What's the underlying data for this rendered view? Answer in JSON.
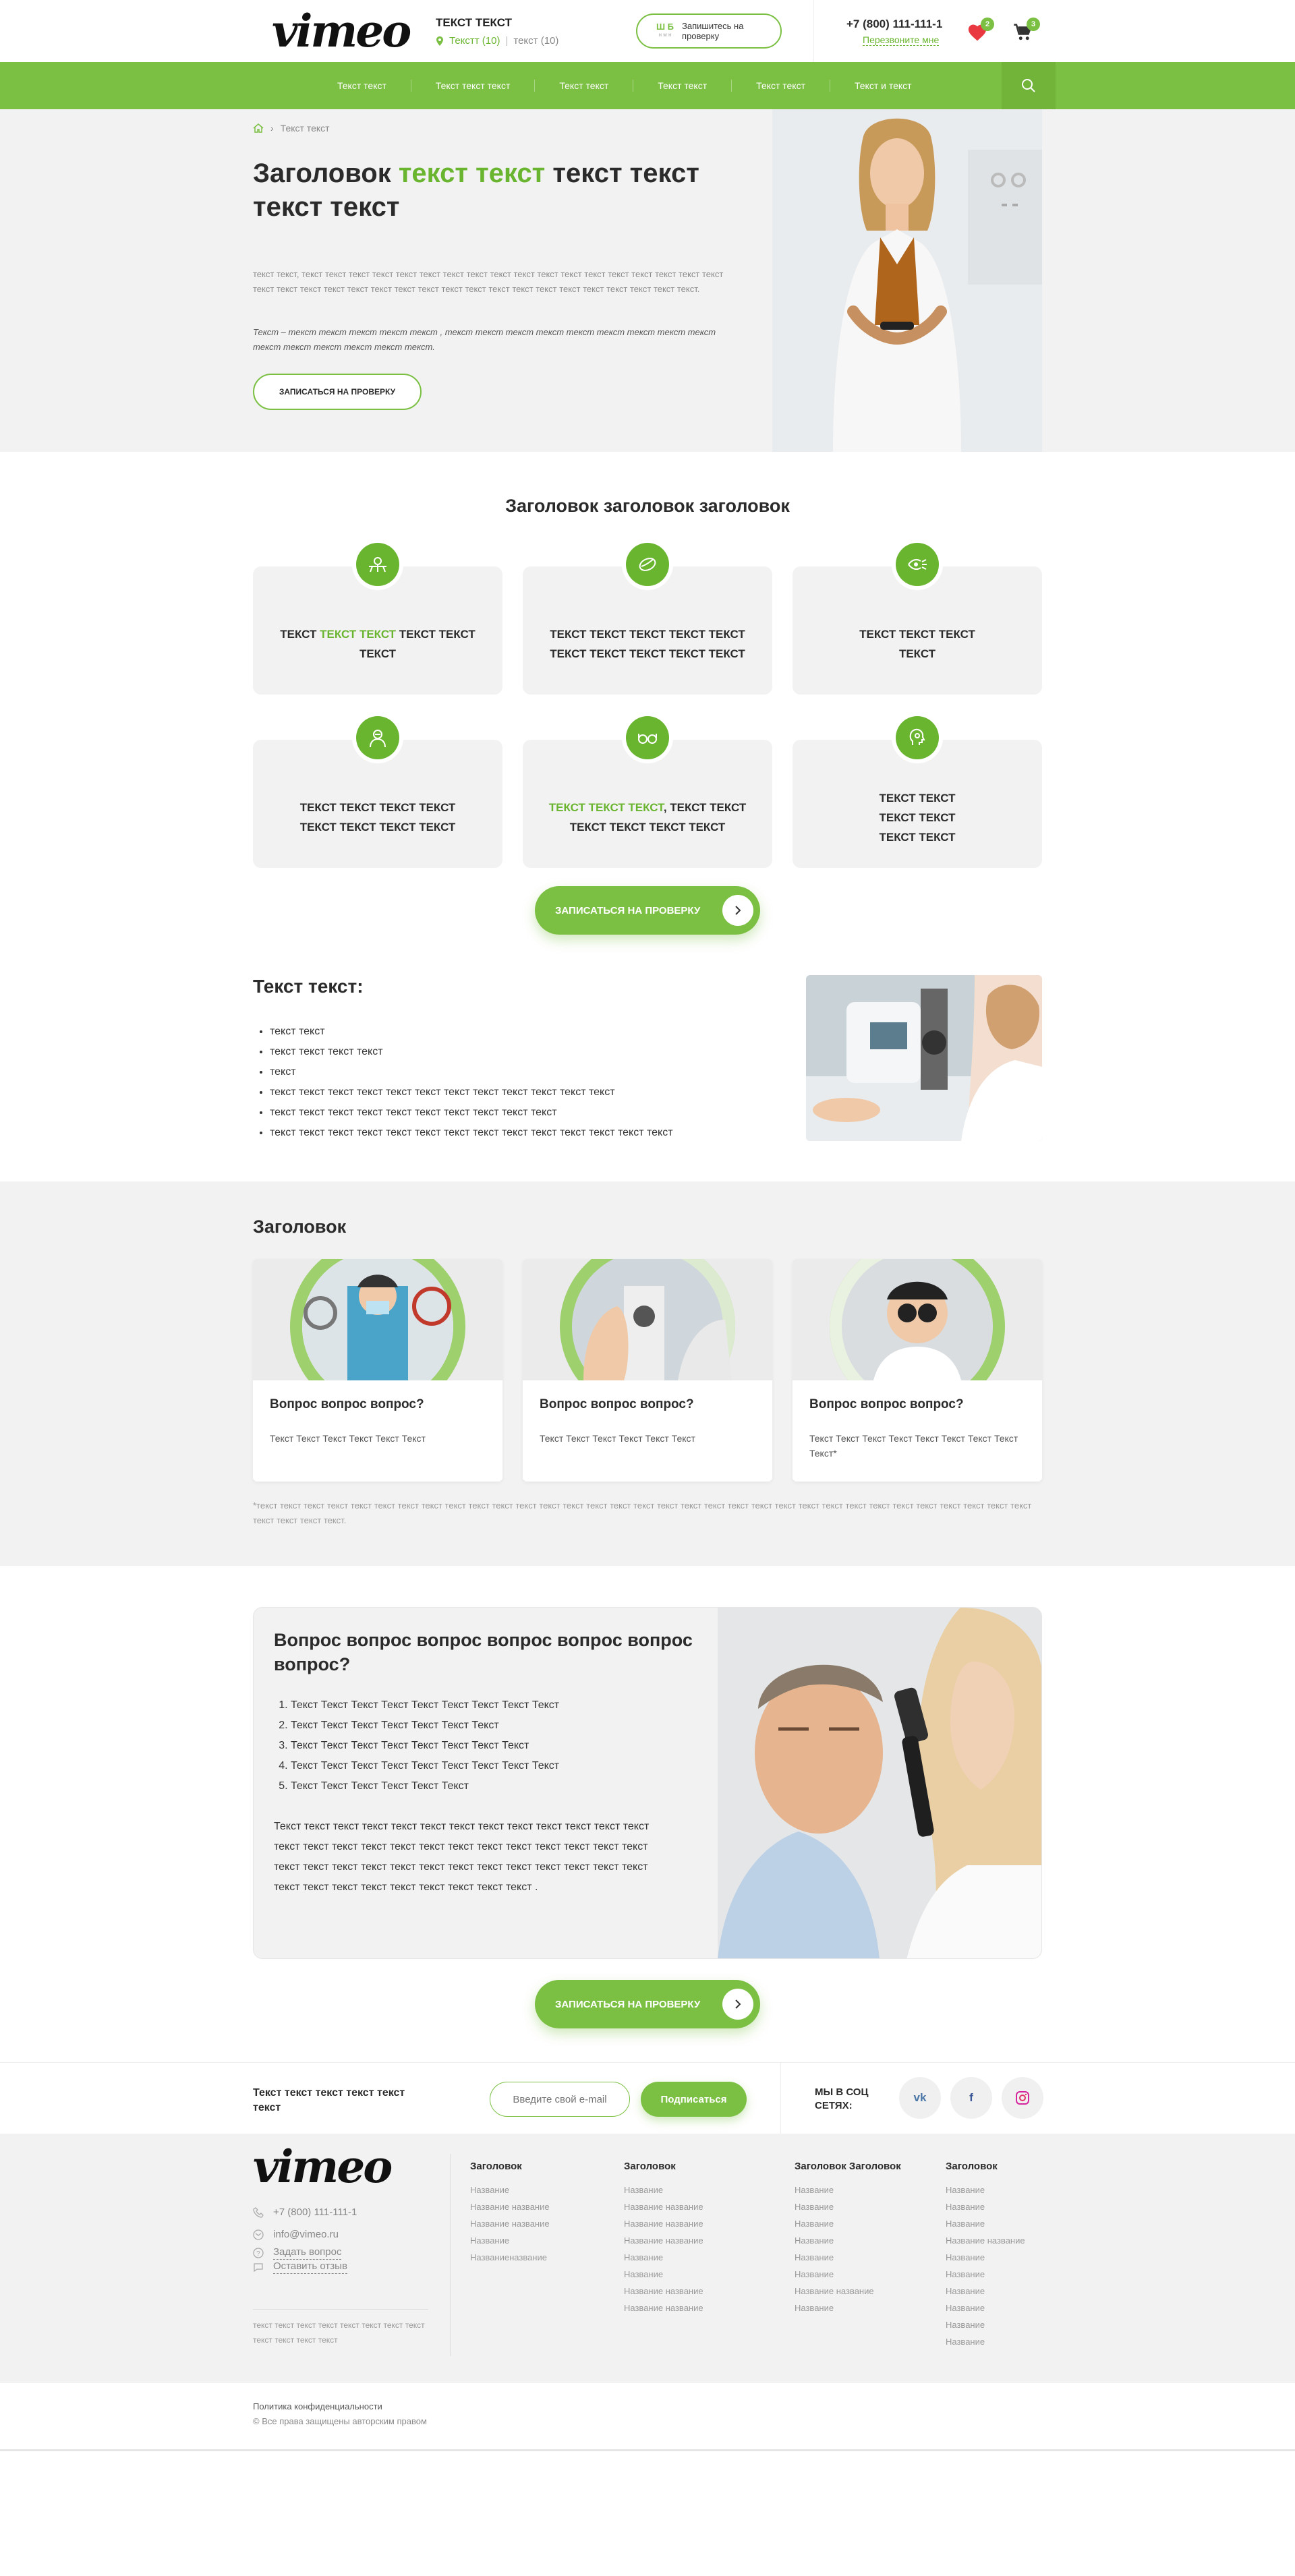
{
  "header": {
    "logo": "vimeo",
    "title": "ТЕКСТ ТЕКСТ",
    "location": "Текстт (10)",
    "location_alt": "текст (10)",
    "promo_badge": "Ш Б",
    "promo_badge_sub": "н м н",
    "promo_line1": "Запишитесь на",
    "promo_line2": "проверку",
    "phone": "+7 (800) 111-111-1",
    "callback": "Перезвоните мне",
    "favorites_count": "2",
    "cart_count": "3"
  },
  "nav": {
    "items": [
      "Текст текст",
      "Текст текст текст",
      "Текст текст",
      "Текст текст",
      "Текст текст",
      "Текст и текст"
    ]
  },
  "hero": {
    "breadcrumb": "Текст текст",
    "title_a": "Заголовок ",
    "title_green": "текст текст",
    "title_b": " текст текст текст текст",
    "para1": "текст текст, текст текст текст текст текст текст текст текст текст текст текст текст текст текст текст текст текст текст текст текст текст текст текст текст текст текст текст текст текст текст текст текст текст текст текст текст текст.",
    "para2": "Текст – текст текст текст  текст  текст , текст  текст  текст текст текст текст текст текст текст текст текст текст текст текст текст.",
    "button": "ЗАПИСАТЬСЯ НА ПРОВЕРКУ"
  },
  "features": {
    "title": "Заголовок заголовок заголовок",
    "cards": [
      {
        "a": "ТЕКСТ ",
        "g": "ТЕКСТ ТЕКСТ",
        "b": " ТЕКСТ ТЕКСТ ТЕКСТ"
      },
      {
        "a": "ТЕКСТ ТЕКСТ ТЕКСТ ТЕКСТ ТЕКСТ ТЕКСТ ТЕКСТ ТЕКСТ ТЕКСТ ТЕКСТ",
        "g": "",
        "b": ""
      },
      {
        "a": "ТЕКСТ ТЕКСТ ТЕКСТ ТЕКСТ",
        "g": "",
        "b": ""
      },
      {
        "a": "ТЕКСТ ТЕКСТ ТЕКСТ ТЕКСТ ТЕКСТ ТЕКСТ ТЕКСТ ТЕКСТ",
        "g": "",
        "b": ""
      },
      {
        "a": "",
        "g": "ТЕКСТ ТЕКСТ ТЕКСТ",
        "b": ", ТЕКСТ ТЕКСТ ТЕКСТ ТЕКСТ ТЕКСТ ТЕКСТ"
      },
      {
        "a": "ТЕКСТ ТЕКСТ ТЕКСТ ТЕКСТ ТЕКСТ ТЕКСТ",
        "g": "",
        "b": ""
      }
    ],
    "button": "ЗАПИСАТЬСЯ НА ПРОВЕРКУ"
  },
  "info": {
    "title": "Текст текст:",
    "items": [
      "текст текст",
      "текст текст текст текст",
      "текст",
      "текст текст текст текст текст текст текст текст текст текст текст текст",
      "текст текст текст текст текст текст текст текст текст текст",
      "текст текст текст текст текст текст текст текст текст текст текст текст текст текст"
    ]
  },
  "questions": {
    "title": "Заголовок",
    "cards": [
      {
        "title": "Вопрос вопрос вопрос?",
        "text": "Текст Текст Текст Текст Текст Текст"
      },
      {
        "title": "Вопрос вопрос вопрос?",
        "text": "Текст Текст Текст Текст Текст Текст"
      },
      {
        "title": "Вопрос вопрос вопрос?",
        "text": "Текст Текст Текст Текст Текст Текст Текст Текст Текст*"
      }
    ],
    "note": "*текст текст текст текст текст текст текст текст текст текст текст текст текст текст текст текст текст текст текст текст текст текст текст текст текст текст текст текст текст текст текст текст текст текст текст текст текст."
  },
  "faq": {
    "title": "Вопрос вопрос вопрос вопрос вопрос вопрос  вопрос?",
    "items": [
      "Текст Текст Текст Текст Текст Текст Текст Текст Текст",
      "Текст Текст Текст Текст Текст Текст Текст",
      "Текст Текст Текст Текст Текст Текст Текст Текст",
      "Текст Текст Текст Текст Текст Текст Текст Текст Текст",
      "Текст Текст Текст Текст Текст Текст"
    ],
    "text": "Текст текст текст текст текст текст текст текст текст текст текст текст текст текст текст текст текст текст текст текст текст текст текст текст текст текст текст текст текст текст текст текст текст текст текст текст текст текст текст текст текст текст текст текст текст текст текст текст .",
    "button": "ЗАПИСАТЬСЯ НА ПРОВЕРКУ"
  },
  "subscribe": {
    "text": "Текст текст текст текст текст текст",
    "placeholder": "Введите свой e-mail",
    "button": "Подписаться",
    "social_label": "МЫ В СОЦ СЕТЯХ:",
    "social": [
      "vk",
      "f"
    ]
  },
  "footer": {
    "logo": "vimeo",
    "phone": "+7 (800) 111-111-1",
    "email": "info@vimeo.ru",
    "ask": "Задать вопрос",
    "review": "Оставить отзыв",
    "small": "текст текст текст текст текст текст текст текст текст текст текст текст",
    "columns": [
      {
        "title": "Заголовок",
        "links": [
          "Название",
          "Название название",
          "Название название",
          "Название",
          "Названиеназвание"
        ]
      },
      {
        "title": "Заголовок",
        "links": [
          "Название",
          "Название название",
          "Название название",
          "Название название",
          "Название",
          "Название",
          "Название название",
          "Название название"
        ]
      },
      {
        "title": "Заголовок Заголовок",
        "links": [
          "Название",
          "Название",
          "Название",
          "Название",
          "Название",
          "Название",
          "Название название",
          "Название"
        ]
      },
      {
        "title": "Заголовок",
        "links": [
          "Название",
          "Название",
          "Название",
          "Название название",
          "Название",
          "Название",
          "Название",
          "Название",
          "Название",
          "Название"
        ]
      }
    ],
    "privacy": "Политика конфиденциальности",
    "copyright": "© Все права защищены авторским правом"
  },
  "colors": {
    "accent": "#7bc043",
    "accent_dark": "#6ab52f",
    "grey_bg": "#f2f2f2"
  }
}
